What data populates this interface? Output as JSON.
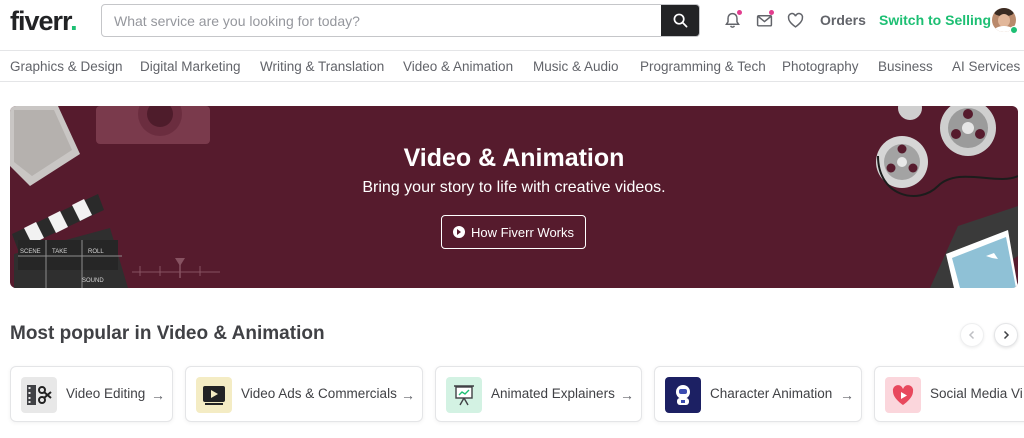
{
  "header": {
    "logo_text": "fiverr",
    "logo_dot": ".",
    "search_placeholder": "What service are you looking for today?",
    "orders_label": "Orders",
    "switch_label": "Switch to Selling"
  },
  "categories": [
    "Graphics & Design",
    "Digital Marketing",
    "Writing & Translation",
    "Video & Animation",
    "Music & Audio",
    "Programming & Tech",
    "Photography",
    "Business",
    "AI Services"
  ],
  "hero": {
    "title": "Video & Animation",
    "subtitle": "Bring your story to life with creative videos.",
    "button_label": "How Fiverr Works",
    "clapper_labels": [
      "SCENE",
      "TAKE",
      "ROLL",
      "SOUND"
    ],
    "background_color": "#561b2d"
  },
  "popular": {
    "title": "Most popular in Video & Animation",
    "cards": [
      {
        "label": "Video Editing",
        "icon": "film-scissors-icon"
      },
      {
        "label": "Video Ads & Commercials",
        "icon": "video-player-icon"
      },
      {
        "label": "Animated Explainers",
        "icon": "presentation-board-icon"
      },
      {
        "label": "Character Animation",
        "icon": "astronaut-icon"
      },
      {
        "label": "Social Media Vi",
        "icon": "heart-play-icon"
      }
    ],
    "arrow": "→"
  },
  "colors": {
    "brand_green": "#1dbf73",
    "notification_pink": "#e23d8e",
    "text_dark": "#404145"
  }
}
